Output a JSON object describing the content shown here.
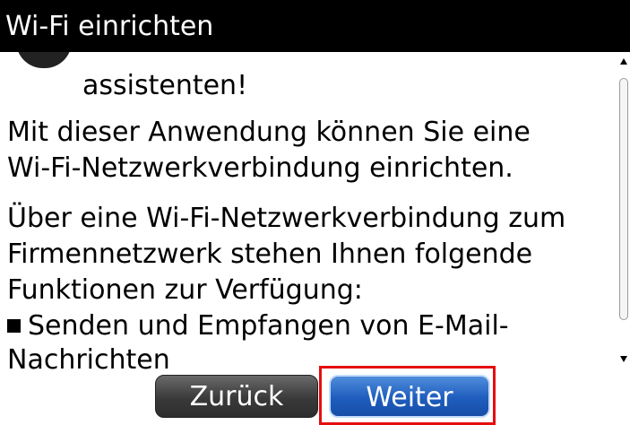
{
  "title": "Wi-Fi einrichten",
  "content": {
    "line_1": "assistenten!",
    "line_2": "Mit dieser Anwendung können Sie eine",
    "line_3": "Wi-Fi-Netzwerkverbindung einrichten.",
    "line_4": "Über eine Wi-Fi-Netzwerkverbindung zum",
    "line_5": "Firmennetzwerk stehen Ihnen folgende",
    "line_6": "Funktionen zur Verfügung:",
    "bullet_1_line_1": "Senden und Empfangen von E-Mail-",
    "bullet_1_line_2": "Nachrichten"
  },
  "buttons": {
    "back_label": "Zurück",
    "next_label": "Weiter"
  },
  "colors": {
    "next_button": "#1e5dbd",
    "back_button": "#3a3a3a",
    "highlight": "#e50e0e"
  }
}
